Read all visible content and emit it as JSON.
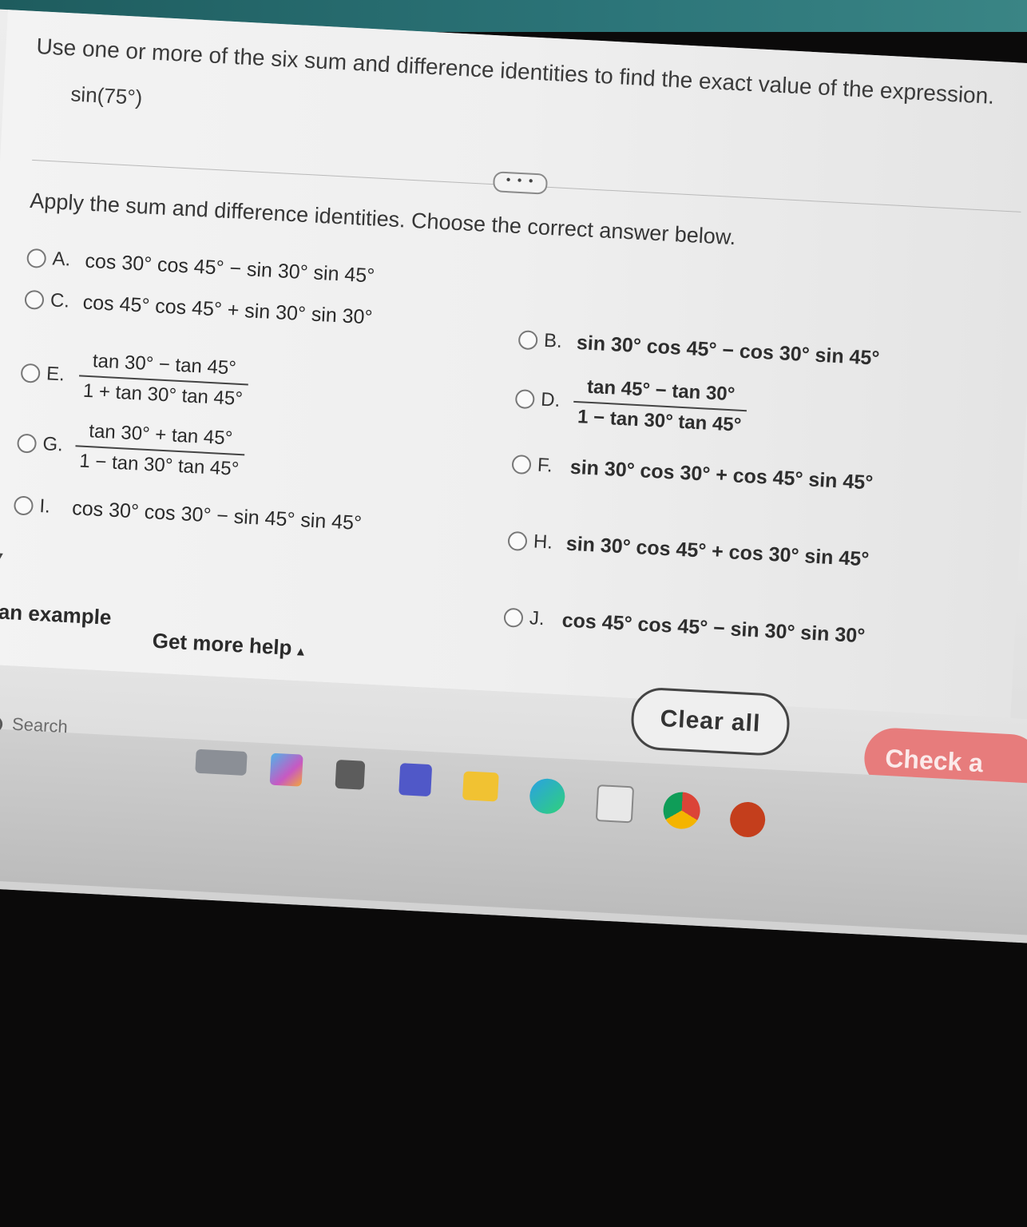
{
  "question": {
    "text": "Use one or more of the six sum and difference identities to find the exact value of the expression.",
    "expression": "sin(75°)"
  },
  "more_button": {
    "label": "• • •"
  },
  "instruction": "Apply the sum and difference identities. Choose the correct answer below.",
  "options": {
    "A": {
      "letter": "A.",
      "expr": "cos 30° cos 45° − sin 30° sin 45°"
    },
    "B": {
      "letter": "B.",
      "expr": "sin 30° cos 45° − cos 30° sin 45°"
    },
    "C": {
      "letter": "C.",
      "expr": "cos 45° cos 45° + sin 30° sin 30°"
    },
    "D": {
      "letter": "D.",
      "numerator": "tan 45° − tan 30°",
      "denominator": "1 − tan 30° tan 45°"
    },
    "E": {
      "letter": "E.",
      "numerator": "tan 30° − tan 45°",
      "denominator": "1 + tan 30° tan 45°"
    },
    "F": {
      "letter": "F.",
      "expr": "sin 30° cos 30° + cos 45° sin 45°"
    },
    "G": {
      "letter": "G.",
      "numerator": "tan 30° + tan 45°",
      "denominator": "1 − tan 30° tan 45°"
    },
    "H": {
      "letter": "H.",
      "expr": "sin 30° cos 45° + cos 30° sin 45°"
    },
    "I": {
      "letter": "I.",
      "expr": "cos 30° cos 30° − sin 45° sin 45°"
    },
    "J": {
      "letter": "J.",
      "expr": "cos 45° cos 45° − sin 30° sin 30°"
    }
  },
  "footer": {
    "view_example": "w an example",
    "get_more_help": "Get more help",
    "get_more_help_caret": "▴",
    "clear_all": "Clear all",
    "check_answer": "Check a"
  },
  "taskbar": {
    "search_label": "Search",
    "apps": [
      "desktop-widget-icon",
      "copilot-icon",
      "file-explorer-icon",
      "teams-icon",
      "folder-icon",
      "edge-icon",
      "store-icon",
      "chrome-icon",
      "powerpoint-icon"
    ]
  },
  "colors": {
    "page_bg": "#efefef",
    "check_button": "#e77c7c",
    "text": "#333333",
    "taskbar_top": "#2c7579"
  }
}
